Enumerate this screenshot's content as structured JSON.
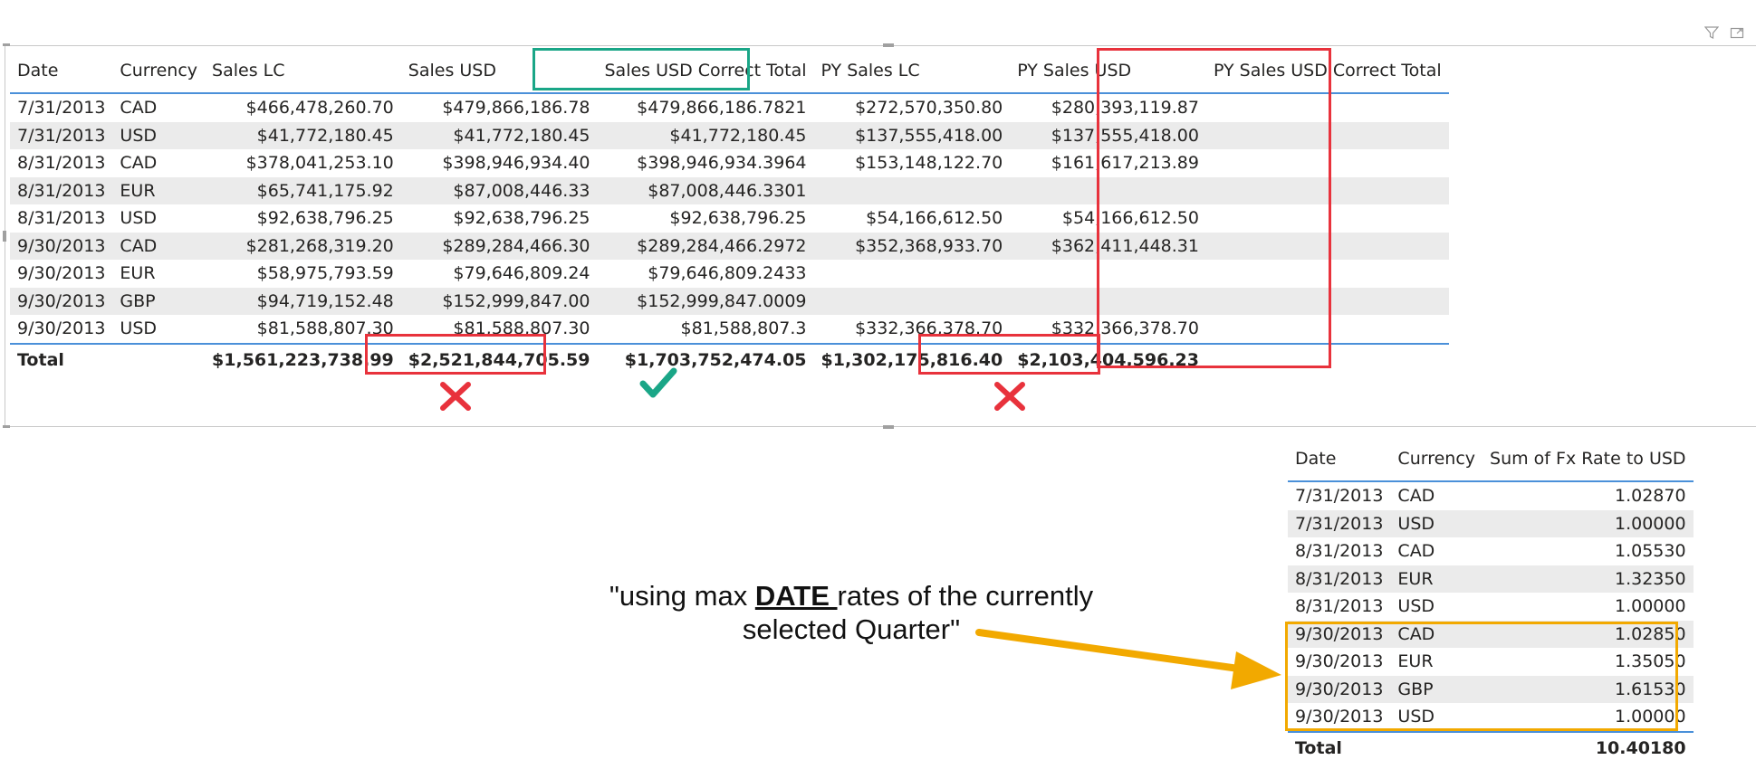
{
  "colors": {
    "wrong_box": "#e8323c",
    "correct_box": "#1aa687",
    "arrow": "#f2a900",
    "header_rule": "#4a90d9",
    "zebra": "#ebebeb"
  },
  "icons": {
    "filter": "filter-icon",
    "focus": "focus-mode-icon"
  },
  "main_table": {
    "headers": [
      "Date",
      "Currency",
      "Sales LC",
      "Sales USD",
      "Sales USD Correct Total",
      "PY Sales LC",
      "PY Sales USD",
      "PY Sales USD Correct Total"
    ],
    "rows": [
      [
        "7/31/2013",
        "CAD",
        "$466,478,260.70",
        "$479,866,186.78",
        "$479,866,186.7821",
        "$272,570,350.80",
        "$280,393,119.87",
        ""
      ],
      [
        "7/31/2013",
        "USD",
        "$41,772,180.45",
        "$41,772,180.45",
        "$41,772,180.45",
        "$137,555,418.00",
        "$137,555,418.00",
        ""
      ],
      [
        "8/31/2013",
        "CAD",
        "$378,041,253.10",
        "$398,946,934.40",
        "$398,946,934.3964",
        "$153,148,122.70",
        "$161,617,213.89",
        ""
      ],
      [
        "8/31/2013",
        "EUR",
        "$65,741,175.92",
        "$87,008,446.33",
        "$87,008,446.3301",
        "",
        "",
        ""
      ],
      [
        "8/31/2013",
        "USD",
        "$92,638,796.25",
        "$92,638,796.25",
        "$92,638,796.25",
        "$54,166,612.50",
        "$54,166,612.50",
        ""
      ],
      [
        "9/30/2013",
        "CAD",
        "$281,268,319.20",
        "$289,284,466.30",
        "$289,284,466.2972",
        "$352,368,933.70",
        "$362,411,448.31",
        ""
      ],
      [
        "9/30/2013",
        "EUR",
        "$58,975,793.59",
        "$79,646,809.24",
        "$79,646,809.2433",
        "",
        "",
        ""
      ],
      [
        "9/30/2013",
        "GBP",
        "$94,719,152.48",
        "$152,999,847.00",
        "$152,999,847.0009",
        "",
        "",
        ""
      ],
      [
        "9/30/2013",
        "USD",
        "$81,588,807.30",
        "$81,588,807.30",
        "$81,588,807.3",
        "$332,366,378.70",
        "$332,366,378.70",
        ""
      ]
    ],
    "total": [
      "Total",
      "",
      "$1,561,223,738.99",
      "$2,521,844,705.59",
      "$1,703,752,474.05",
      "$1,302,175,816.40",
      "$2,103,404,596.23",
      ""
    ]
  },
  "fx_table": {
    "headers": [
      "Date",
      "Currency",
      "Sum of Fx Rate to USD"
    ],
    "rows": [
      [
        "7/31/2013",
        "CAD",
        "1.02870"
      ],
      [
        "7/31/2013",
        "USD",
        "1.00000"
      ],
      [
        "8/31/2013",
        "CAD",
        "1.05530"
      ],
      [
        "8/31/2013",
        "EUR",
        "1.32350"
      ],
      [
        "8/31/2013",
        "USD",
        "1.00000"
      ],
      [
        "9/30/2013",
        "CAD",
        "1.02850"
      ],
      [
        "9/30/2013",
        "EUR",
        "1.35050"
      ],
      [
        "9/30/2013",
        "GBP",
        "1.61530"
      ],
      [
        "9/30/2013",
        "USD",
        "1.00000"
      ]
    ],
    "total": [
      "Total",
      "",
      "10.40180"
    ]
  },
  "annotation": {
    "line1_pre": "\"using max ",
    "keyword": "DATE ",
    "line1_post": "rates of the currently",
    "line2": "selected Quarter\""
  }
}
